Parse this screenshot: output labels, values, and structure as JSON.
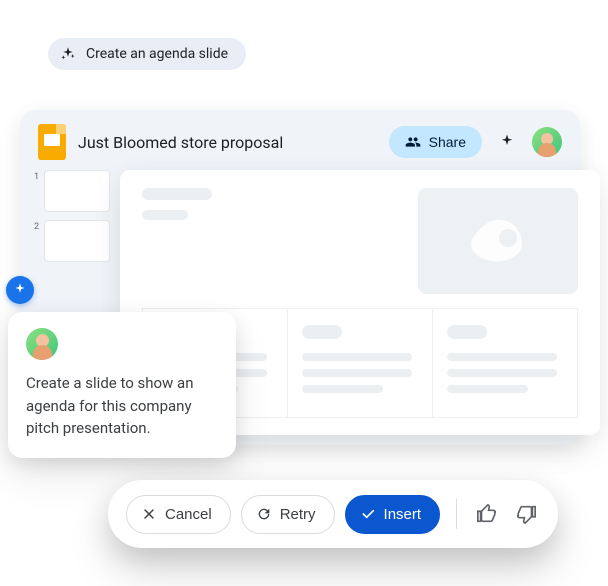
{
  "chip": {
    "label": "Create an agenda slide"
  },
  "header": {
    "doc_title": "Just Bloomed store proposal",
    "share_label": "Share"
  },
  "thumbs": [
    {
      "num": "1"
    },
    {
      "num": "2"
    }
  ],
  "prompt": {
    "text": "Create a slide to show an agenda for this company pitch presentation."
  },
  "actions": {
    "cancel_label": "Cancel",
    "retry_label": "Retry",
    "insert_label": "Insert"
  }
}
